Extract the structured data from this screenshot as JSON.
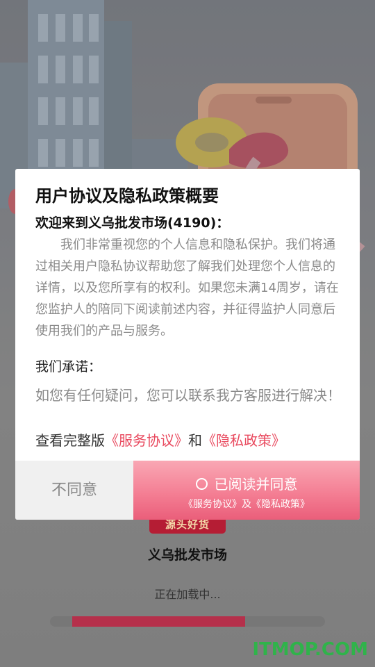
{
  "dialog": {
    "title": "用户协议及隐私政策概要",
    "welcome": "欢迎来到义乌批发市场(4190)：",
    "body": "我们非常重视您的个人信息和隐私保护。我们将通过相关用户隐私协议帮助您了解我们处理您个人信息的详情，以及您所享有的权利。如果您未满14周岁，请在您监护人的陪同下阅读前述内容，并征得监护人同意后使用我们的产品与服务。",
    "promise_label": "我们承诺：",
    "contact": "如您有任何疑问，您可以联系我方客服进行解决！",
    "view_prefix": "查看完整版",
    "service_link": "《服务协议》",
    "and_text": "和",
    "privacy_link": "《隐私政策》",
    "disagree_label": "不同意",
    "agree_label": "已阅读并同意",
    "agree_sub": "《服务协议》及《隐私政策》"
  },
  "splash": {
    "badge": "源头好货",
    "app_name": "义乌批发市场",
    "loading_text": "正在加载中...",
    "progress_start": 0.08,
    "progress_end": 0.71
  },
  "watermark": "ITMOP.COM",
  "colors": {
    "accent_pink": "#e94a5f",
    "agree_gradient_top": "#f9a7b4",
    "agree_gradient_bottom": "#ea5e7a",
    "badge_red": "#b51d34",
    "progress_fill": "#b5304b",
    "watermark_green": "#2fb34a"
  }
}
